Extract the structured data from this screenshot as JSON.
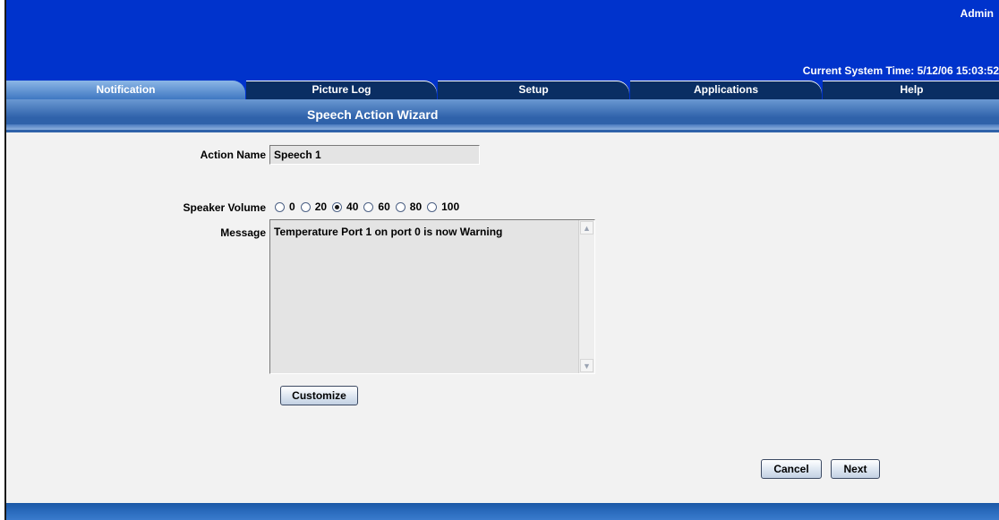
{
  "header": {
    "user": "Admin",
    "system_time": "Current System Time: 5/12/06 15:03:52"
  },
  "tabs": [
    {
      "label": "Notification",
      "active": true
    },
    {
      "label": "Picture Log",
      "active": false
    },
    {
      "label": "Setup",
      "active": false
    },
    {
      "label": "Applications",
      "active": false
    },
    {
      "label": "Help",
      "active": false
    }
  ],
  "wizard": {
    "title": "Speech Action Wizard"
  },
  "form": {
    "action_name_label": "Action Name",
    "action_name_value": "Speech 1",
    "volume_label": "Speaker Volume",
    "volume_options": [
      "0",
      "20",
      "40",
      "60",
      "80",
      "100"
    ],
    "volume_selected": "40",
    "message_label": "Message",
    "message_value": "Temperature Port 1 on port 0 is now Warning"
  },
  "buttons": {
    "customize": "Customize",
    "cancel": "Cancel",
    "next": "Next"
  },
  "colors": {
    "banner": "#0033cc",
    "tab_inactive": "#0a2e63",
    "tab_active": "#5b8fd6"
  }
}
